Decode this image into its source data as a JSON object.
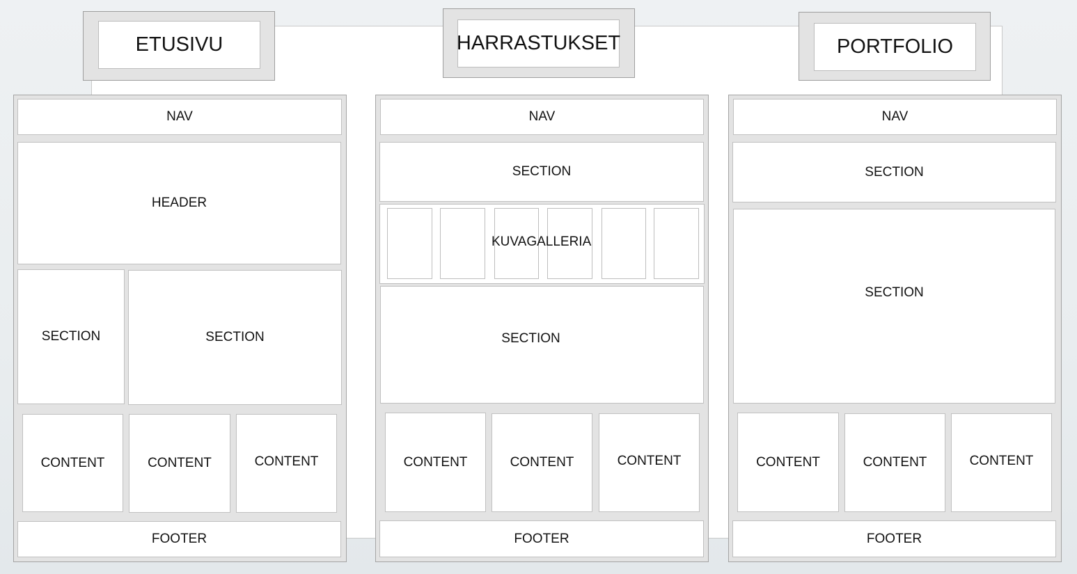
{
  "pages": [
    {
      "tab": "ETUSIVU",
      "nav": "NAV",
      "header": "HEADER",
      "sections": [
        "SECTION",
        "SECTION"
      ],
      "contents": [
        "CONTENT",
        "CONTENT",
        "CONTENT"
      ],
      "footer": "FOOTER"
    },
    {
      "tab": "HARRASTUKSET",
      "nav": "NAV",
      "sections": [
        "SECTION",
        "SECTION"
      ],
      "gallery": "KUVAGALLERIA",
      "contents": [
        "CONTENT",
        "CONTENT",
        "CONTENT"
      ],
      "footer": "FOOTER"
    },
    {
      "tab": "PORTFOLIO",
      "nav": "NAV",
      "sections": [
        "SECTION",
        "SECTION"
      ],
      "contents": [
        "CONTENT",
        "CONTENT",
        "CONTENT"
      ],
      "footer": "FOOTER"
    }
  ]
}
